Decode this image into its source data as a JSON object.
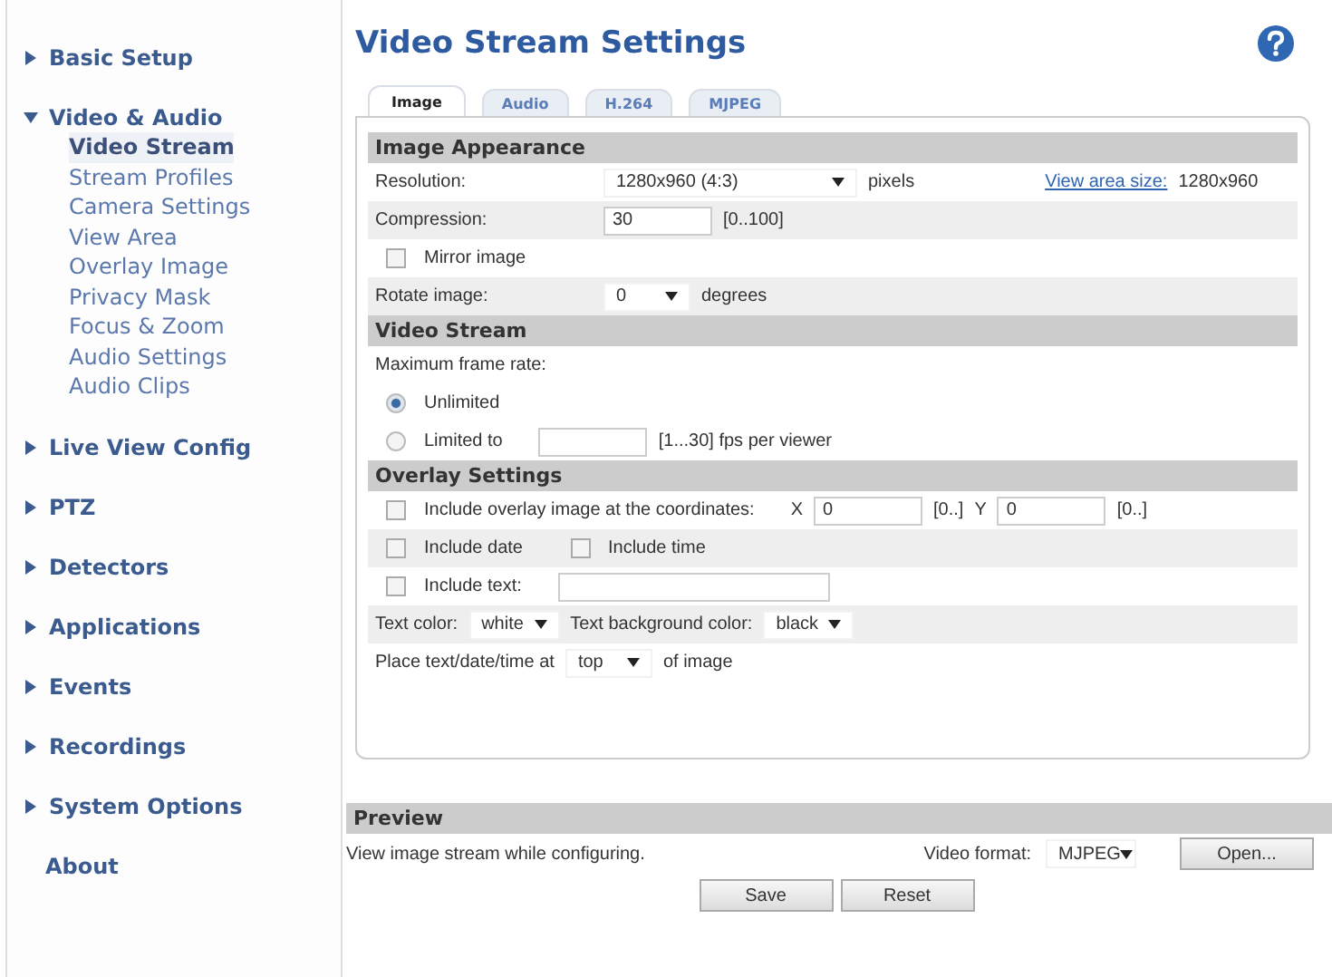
{
  "sidebar": {
    "items": [
      {
        "label": "Basic Setup",
        "kind": "group",
        "expanded": false
      },
      {
        "label": "Video & Audio",
        "kind": "group",
        "expanded": true,
        "children": [
          {
            "label": "Video Stream",
            "selected": true
          },
          {
            "label": "Stream Profiles",
            "selected": false
          },
          {
            "label": "Camera Settings",
            "selected": false
          },
          {
            "label": "View Area",
            "selected": false
          },
          {
            "label": "Overlay Image",
            "selected": false
          },
          {
            "label": "Privacy Mask",
            "selected": false
          },
          {
            "label": "Focus & Zoom",
            "selected": false
          },
          {
            "label": "Audio Settings",
            "selected": false
          },
          {
            "label": "Audio Clips",
            "selected": false
          }
        ]
      },
      {
        "label": "Live View Config",
        "kind": "group",
        "expanded": false
      },
      {
        "label": "PTZ",
        "kind": "group",
        "expanded": false
      },
      {
        "label": "Detectors",
        "kind": "group",
        "expanded": false
      },
      {
        "label": "Applications",
        "kind": "group",
        "expanded": false
      },
      {
        "label": "Events",
        "kind": "group",
        "expanded": false
      },
      {
        "label": "Recordings",
        "kind": "group",
        "expanded": false
      },
      {
        "label": "System Options",
        "kind": "group",
        "expanded": false
      },
      {
        "label": "About",
        "kind": "link"
      }
    ]
  },
  "page": {
    "title": "Video Stream Settings"
  },
  "tabs": [
    {
      "label": "Image",
      "selected": true
    },
    {
      "label": "Audio",
      "selected": false
    },
    {
      "label": "H.264",
      "selected": false
    },
    {
      "label": "MJPEG",
      "selected": false
    }
  ],
  "sections": [
    {
      "title": "Image Appearance",
      "rows": [
        {
          "shaded": false,
          "items": [
            {
              "kind": "label",
              "text": "Resolution:"
            },
            {
              "kind": "select",
              "value": "1280x960 (4:3)"
            },
            {
              "kind": "text",
              "text": "pixels"
            },
            {
              "kind": "link",
              "text": "View area size:"
            },
            {
              "kind": "text",
              "text": "1280x960"
            }
          ]
        },
        {
          "shaded": true,
          "items": [
            {
              "kind": "label",
              "text": "Compression:"
            },
            {
              "kind": "input",
              "value": "30"
            },
            {
              "kind": "text",
              "text": "[0..100]"
            }
          ]
        },
        {
          "shaded": false,
          "items": [
            {
              "kind": "checkbox",
              "label": "Mirror image",
              "checked": false
            }
          ]
        },
        {
          "shaded": true,
          "items": [
            {
              "kind": "label",
              "text": "Rotate image:"
            },
            {
              "kind": "select",
              "value": "0"
            },
            {
              "kind": "text",
              "text": "degrees"
            }
          ]
        }
      ]
    },
    {
      "title": "Video Stream",
      "rows": [
        {
          "shaded": false,
          "items": [
            {
              "kind": "text",
              "text": "Maximum frame rate:"
            }
          ]
        },
        {
          "shaded": false,
          "items": [
            {
              "kind": "radio",
              "label": "Unlimited",
              "selected": true
            }
          ]
        },
        {
          "shaded": false,
          "items": [
            {
              "kind": "radio",
              "label": "Limited to",
              "selected": false
            },
            {
              "kind": "input"
            },
            {
              "kind": "text",
              "text": "[1...30] fps per viewer"
            }
          ]
        }
      ]
    },
    {
      "title": "Overlay Settings",
      "rows": [
        {
          "shaded": false,
          "items": [
            {
              "kind": "checkbox",
              "label": "Include overlay image at the coordinates:",
              "checked": false
            },
            {
              "kind": "text",
              "text": "X"
            },
            {
              "kind": "input",
              "value": "0"
            },
            {
              "kind": "text",
              "text": "[0..]"
            },
            {
              "kind": "text",
              "text": "Y"
            },
            {
              "kind": "input",
              "value": "0"
            },
            {
              "kind": "text",
              "text": "[0..]"
            }
          ]
        },
        {
          "shaded": true,
          "items": [
            {
              "kind": "checkbox",
              "label": "Include date",
              "checked": false
            },
            {
              "kind": "checkbox",
              "label": "Include time",
              "checked": false
            }
          ]
        },
        {
          "shaded": false,
          "items": [
            {
              "kind": "checkbox",
              "label": "Include text:",
              "checked": false
            },
            {
              "kind": "input"
            }
          ]
        },
        {
          "shaded": true,
          "items": [
            {
              "kind": "text",
              "text": "Text color:"
            },
            {
              "kind": "select",
              "value": "white"
            },
            {
              "kind": "text",
              "text": "Text background color:"
            },
            {
              "kind": "select",
              "value": "black"
            }
          ]
        },
        {
          "shaded": false,
          "items": [
            {
              "kind": "text",
              "text": "Place text/date/time at"
            },
            {
              "kind": "select",
              "value": "top"
            },
            {
              "kind": "text",
              "text": "of image"
            }
          ]
        }
      ]
    }
  ],
  "preview": {
    "title": "Preview",
    "description": "View image stream while configuring.",
    "format_label": "Video format:",
    "format": "MJPEG",
    "open_button": "Open..."
  },
  "buttons": [
    "Save",
    "Reset"
  ]
}
